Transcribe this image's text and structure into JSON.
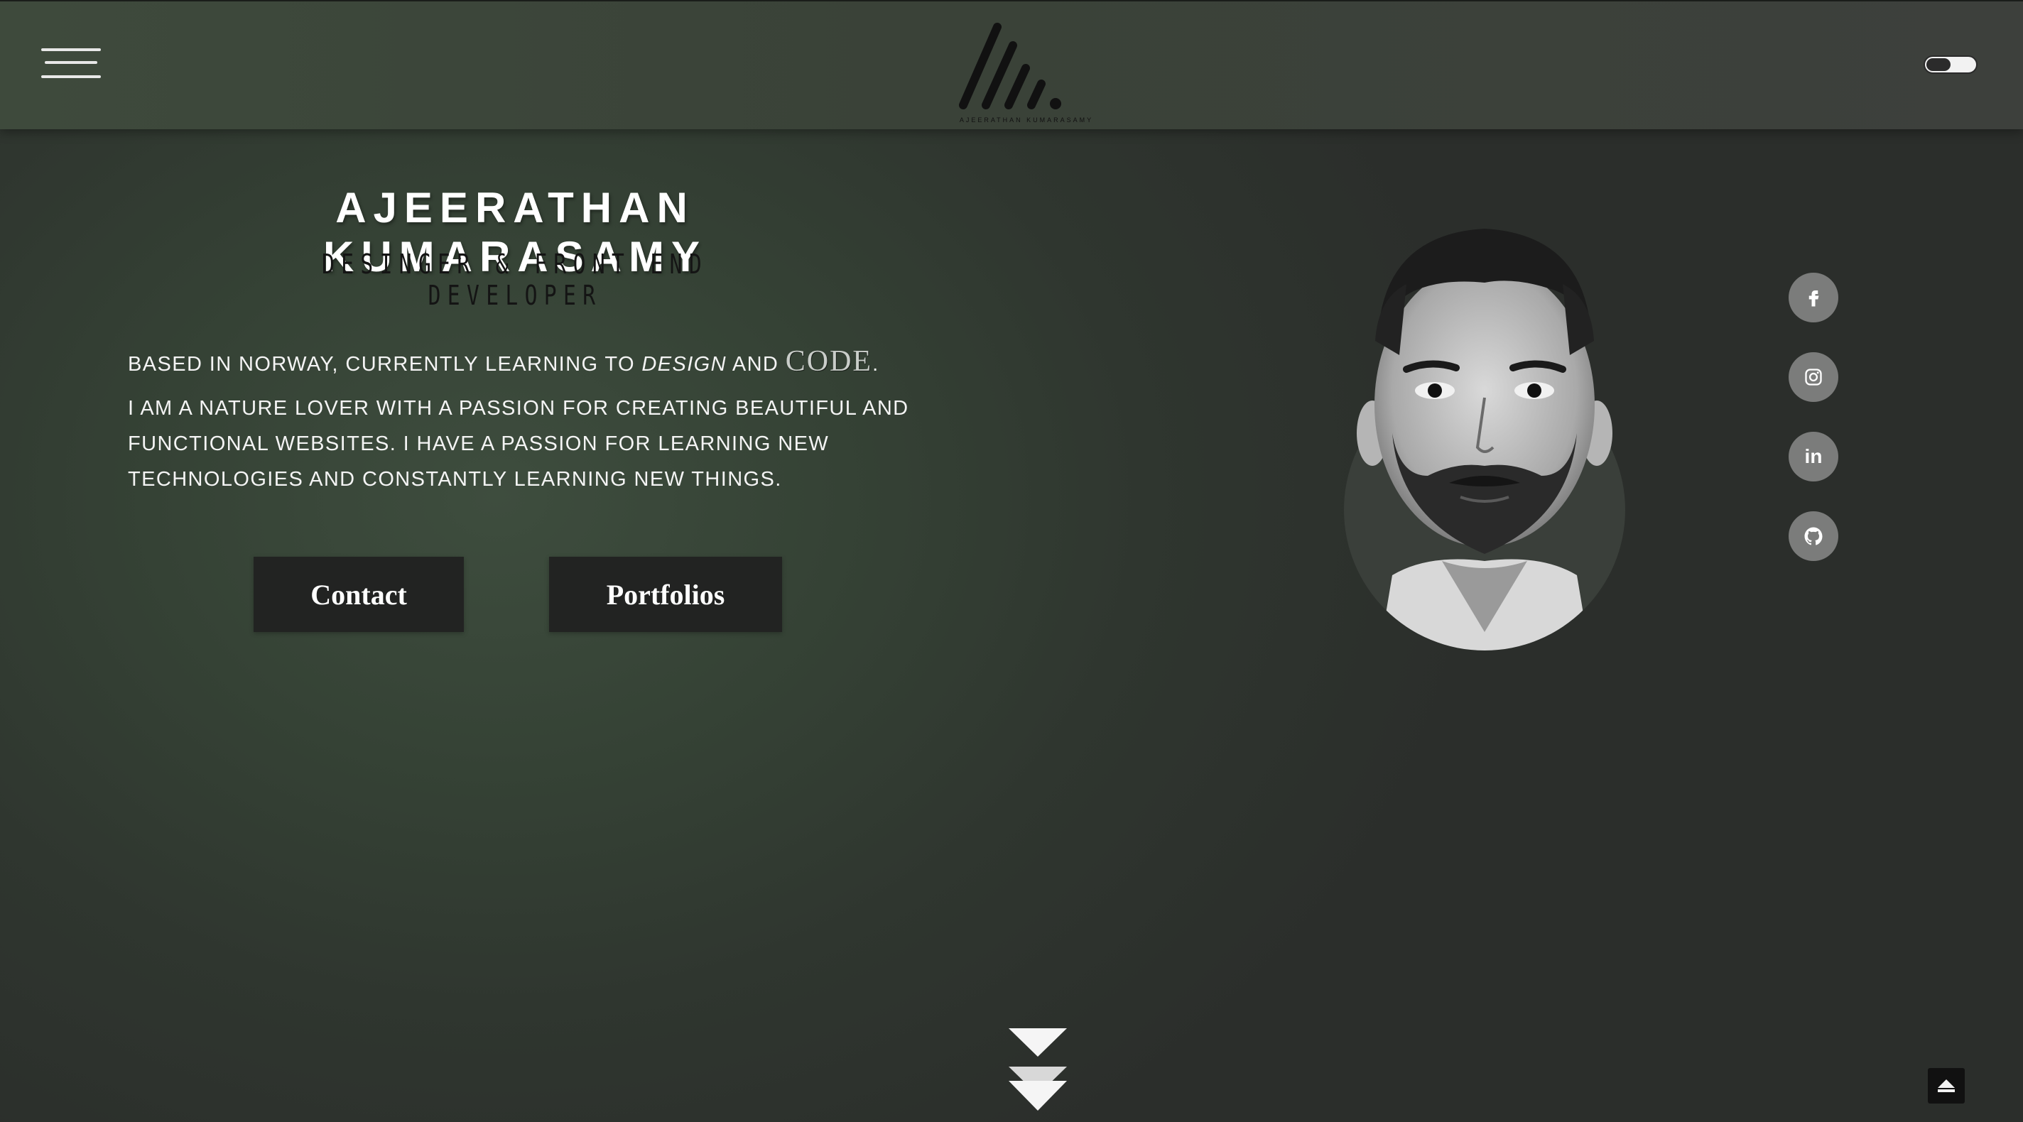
{
  "header": {
    "logo_caption": "AJEERATHAN KUMARASAMY",
    "menu_icon": "hamburger-menu-icon",
    "theme_toggle_icon": "dark-mode-toggle"
  },
  "hero": {
    "name": "AJEERATHAN KUMARASAMY",
    "role": "DESINGER & FRONT END DEVELOPER",
    "bio_line1_a": "BASED IN NORWAY, CURRENTLY LEARNING TO ",
    "bio_line1_design": "DESIGN",
    "bio_line1_and": " AND ",
    "bio_line1_code": "CODE",
    "bio_line1_end": ".",
    "bio_paragraph": "I AM A NATURE LOVER WITH A PASSION FOR CREATING BEAUTIFUL AND FUNCTIONAL WEBSITES. I HAVE A PASSION FOR LEARNING NEW TECHNOLOGIES AND CONSTANTLY LEARNING NEW THINGS.",
    "buttons": {
      "contact": "Contact",
      "portfolios": "Portfolios"
    }
  },
  "social": [
    {
      "name": "facebook",
      "icon": "facebook-icon"
    },
    {
      "name": "instagram",
      "icon": "instagram-icon"
    },
    {
      "name": "linkedin",
      "icon": "linkedin-icon",
      "glyph": "in"
    },
    {
      "name": "github",
      "icon": "github-icon"
    }
  ],
  "colors": {
    "background": "#354235",
    "header": "#3a4238",
    "button": "#222322",
    "social_circle": "#7b7c7b",
    "text": "#ffffff"
  }
}
